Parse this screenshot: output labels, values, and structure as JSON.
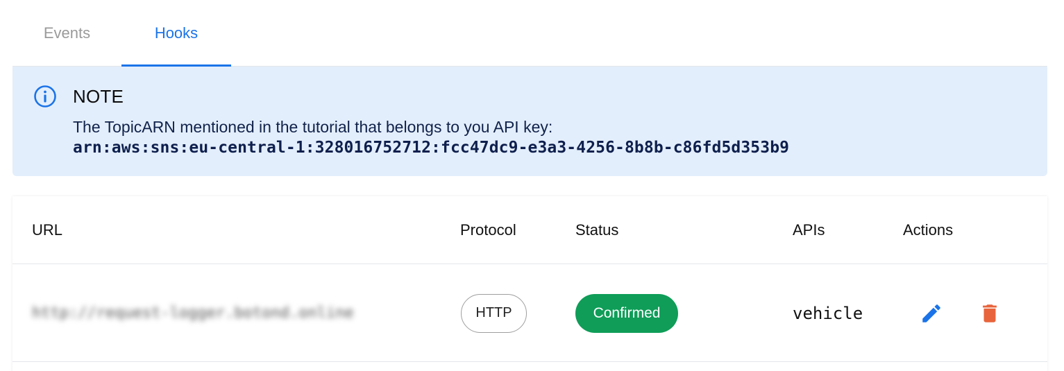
{
  "tabs": [
    {
      "label": "Events",
      "active": false
    },
    {
      "label": "Hooks",
      "active": true
    }
  ],
  "note": {
    "title": "NOTE",
    "text": "The TopicARN mentioned in the tutorial that belongs to you API key:",
    "arn": "arn:aws:sns:eu-central-1:328016752712:fcc47dc9-e3a3-4256-8b8b-c86fd5d353b9",
    "icon": "info-icon"
  },
  "table": {
    "headers": {
      "url": "URL",
      "protocol": "Protocol",
      "status": "Status",
      "apis": "APIs",
      "actions": "Actions"
    },
    "rows": [
      {
        "url": "http://request-logger.botond.online",
        "protocol": "HTTP",
        "status": "Confirmed",
        "apis": "vehicle",
        "actions": [
          "edit-icon",
          "delete-icon"
        ]
      }
    ]
  },
  "colors": {
    "accent": "#1a73e8",
    "note_background": "#e3eefc",
    "status_confirmed": "#0f9d58",
    "delete": "#e8643c"
  }
}
